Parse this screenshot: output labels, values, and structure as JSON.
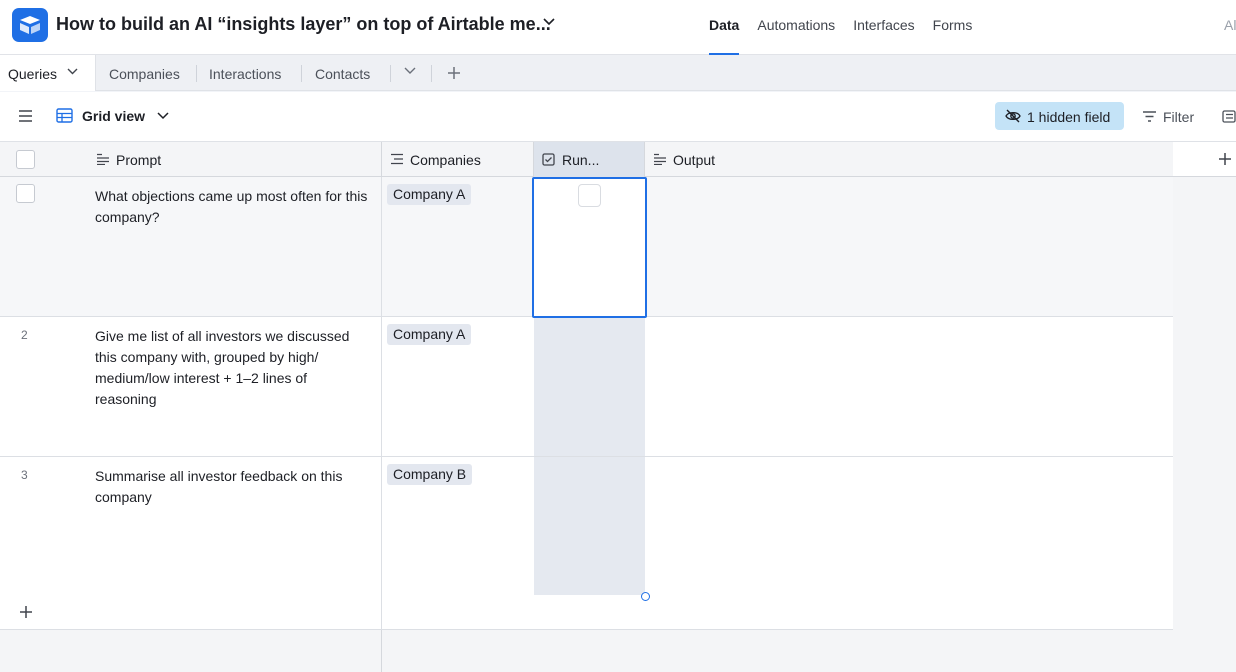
{
  "header": {
    "base_title": "How to build an AI “insights layer” on top of Airtable me...",
    "nav": [
      "Data",
      "Automations",
      "Interfaces",
      "Forms"
    ],
    "active_nav": "Data",
    "right_text": "Al"
  },
  "tabs": {
    "active": "Queries",
    "others": [
      "Companies",
      "Interactions",
      "Contacts"
    ]
  },
  "viewbar": {
    "view_name": "Grid view",
    "hidden_fields": "1 hidden field",
    "filter": "Filter"
  },
  "columns": {
    "prompt": "Prompt",
    "companies": "Companies",
    "run": "Run...",
    "output": "Output"
  },
  "rows": [
    {
      "num": "",
      "prompt": "What objections came up most often for this company?",
      "company": "Company A"
    },
    {
      "num": "2",
      "prompt": "Give me list of all investors we discussed this company with, grouped by high/ medium/low interest + 1–2 lines of reasoning",
      "company": "Company A"
    },
    {
      "num": "3",
      "prompt": "Summarise all investor feedback on this company",
      "company": "Company B"
    }
  ],
  "colors": {
    "accent": "#1f6fe5",
    "hidden_field_bg": "#c4e3f7",
    "selected_column_bg": "#e5e9f0"
  }
}
